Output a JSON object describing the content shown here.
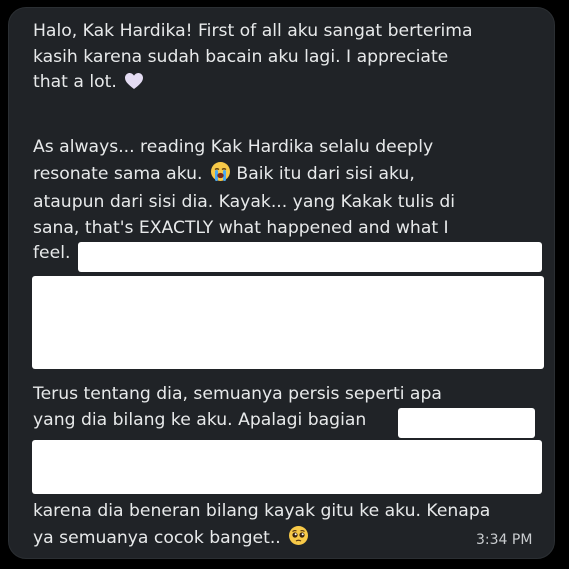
{
  "message": {
    "paragraph1": {
      "line1": "Halo, Kak Hardika! First of all aku sangat berterima",
      "line2": "kasih karena sudah bacain aku lagi. I appreciate",
      "line3": "that a lot."
    },
    "paragraph2": {
      "line1": "As always... reading Kak Hardika selalu deeply",
      "line2": "resonate sama aku.",
      "line2b": "Baik itu dari sisi aku,",
      "line3": "ataupun dari sisi dia. Kayak... yang Kakak tulis di",
      "line4": "sana, that's EXACTLY what happened and what I",
      "line5": "feel."
    },
    "paragraph3": {
      "line1": "Terus tentang dia, semuanya persis seperti apa",
      "line2": "yang dia bilang ke aku. Apalagi bagian"
    },
    "paragraph4": {
      "line1": "karena dia beneran bilang kayak gitu ke aku. Kenapa",
      "line2": "ya semuanya cocok banget.."
    },
    "timestamp": "3:34 PM"
  },
  "icons": {
    "heart": "white-heart-icon",
    "crying_face": "loudly-crying-face-icon",
    "pleading_face": "pleading-face-icon"
  },
  "colors": {
    "background": "#000000",
    "bubble": "#202327",
    "text": "#e7e9ea",
    "timestamp": "#c9cccf",
    "redaction": "#ffffff"
  }
}
